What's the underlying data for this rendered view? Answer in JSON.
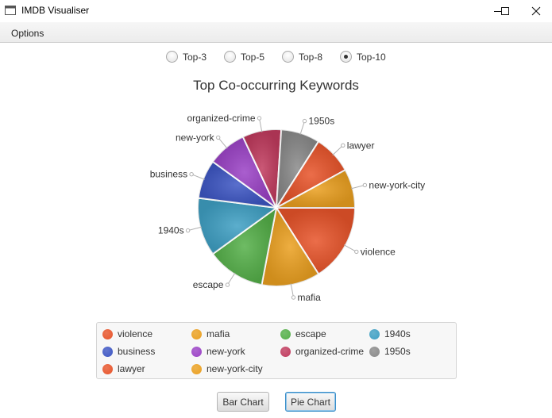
{
  "window": {
    "title": "IMDB Visualiser",
    "icon": "window-app-icon",
    "controls": [
      "minimize-icon",
      "maximize-icon",
      "close-icon"
    ]
  },
  "menu": {
    "options_label": "Options"
  },
  "top_selector": {
    "options": [
      "Top-3",
      "Top-5",
      "Top-8",
      "Top-10"
    ],
    "selected": "Top-10"
  },
  "chart_data": {
    "type": "pie",
    "title": "Top Co-occurring Keywords",
    "labels": [
      "violence",
      "mafia",
      "escape",
      "1940s",
      "business",
      "new-york",
      "organized-crime",
      "1950s",
      "lawyer",
      "new-york-city"
    ],
    "values": [
      16,
      12,
      12,
      12,
      8,
      8,
      8,
      8,
      8,
      8
    ],
    "colors": [
      "#e8542a",
      "#eba020",
      "#55b049",
      "#3fa0c4",
      "#3d56c4",
      "#9b42c6",
      "#c13b5e",
      "#8a8a8a",
      "#e8542a",
      "#eba020"
    ],
    "legend": "bottom"
  },
  "buttons": {
    "bar_chart": "Bar Chart",
    "pie_chart": "Pie Chart",
    "active": "Pie Chart"
  }
}
